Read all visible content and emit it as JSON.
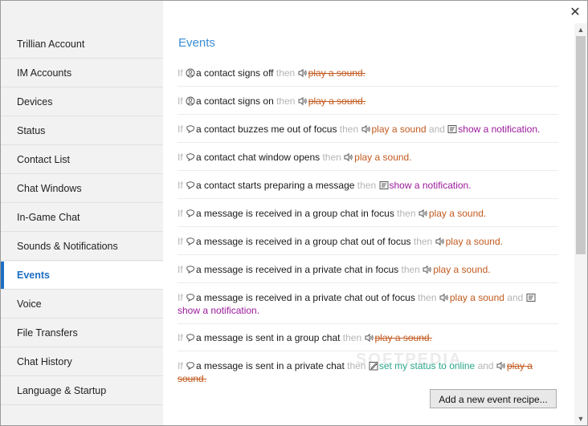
{
  "close_label": "✕",
  "sidebar": {
    "items": [
      {
        "label": "Trillian Account",
        "active": false
      },
      {
        "label": "IM Accounts",
        "active": false
      },
      {
        "label": "Devices",
        "active": false
      },
      {
        "label": "Status",
        "active": false
      },
      {
        "label": "Contact List",
        "active": false
      },
      {
        "label": "Chat Windows",
        "active": false
      },
      {
        "label": "In-Game Chat",
        "active": false
      },
      {
        "label": "Sounds & Notifications",
        "active": false
      },
      {
        "label": "Events",
        "active": true
      },
      {
        "label": "Voice",
        "active": false
      },
      {
        "label": "File Transfers",
        "active": false
      },
      {
        "label": "Chat History",
        "active": false
      },
      {
        "label": "Language & Startup",
        "active": false
      }
    ]
  },
  "main": {
    "heading": "Events",
    "keyword_if": "If",
    "keyword_then": "then",
    "keyword_and": "and",
    "events": [
      {
        "trigger": "a contact signs off",
        "actions": [
          {
            "type": "sound",
            "label": "play a sound.",
            "disabled": true
          }
        ]
      },
      {
        "trigger": "a contact signs on",
        "actions": [
          {
            "type": "sound",
            "label": "play a sound.",
            "disabled": true
          }
        ]
      },
      {
        "trigger": "a contact buzzes me out of focus",
        "actions": [
          {
            "type": "sound",
            "label": "play a sound",
            "disabled": false
          },
          {
            "type": "notify",
            "label": "show a notification.",
            "disabled": false
          }
        ]
      },
      {
        "trigger": "a contact chat window opens",
        "actions": [
          {
            "type": "sound",
            "label": "play a sound.",
            "disabled": false
          }
        ]
      },
      {
        "trigger": "a contact starts preparing a message",
        "actions": [
          {
            "type": "notify",
            "label": "show a notification.",
            "disabled": false
          }
        ]
      },
      {
        "trigger": "a message is received in a group chat in focus",
        "actions": [
          {
            "type": "sound",
            "label": "play a sound.",
            "disabled": false
          }
        ]
      },
      {
        "trigger": "a message is received in a group chat out of focus",
        "actions": [
          {
            "type": "sound",
            "label": "play a sound.",
            "disabled": false
          }
        ]
      },
      {
        "trigger": "a message is received in a private chat in focus",
        "actions": [
          {
            "type": "sound",
            "label": "play a sound.",
            "disabled": false
          }
        ]
      },
      {
        "trigger": "a message is received in a private chat out of focus",
        "actions": [
          {
            "type": "sound",
            "label": "play a sound",
            "disabled": false
          },
          {
            "type": "notify",
            "label": "show a notification.",
            "disabled": false
          }
        ]
      },
      {
        "trigger": "a message is sent in a group chat",
        "actions": [
          {
            "type": "sound",
            "label": "play a sound.",
            "disabled": true
          }
        ]
      },
      {
        "trigger": "a message is sent in a private chat",
        "actions": [
          {
            "type": "status",
            "label": "set my status to online",
            "disabled": false
          },
          {
            "type": "sound",
            "label": "play a sound.",
            "disabled": true
          }
        ]
      }
    ],
    "add_button": "Add a new event recipe..."
  },
  "watermark": "SOFTPEDIA",
  "colors": {
    "accent": "#1c6fc4",
    "heading": "#3a8dd4",
    "sound": "#c25a1f",
    "notify": "#9a1a9a",
    "status": "#2aa78c",
    "keyword": "#b4b4b4"
  }
}
